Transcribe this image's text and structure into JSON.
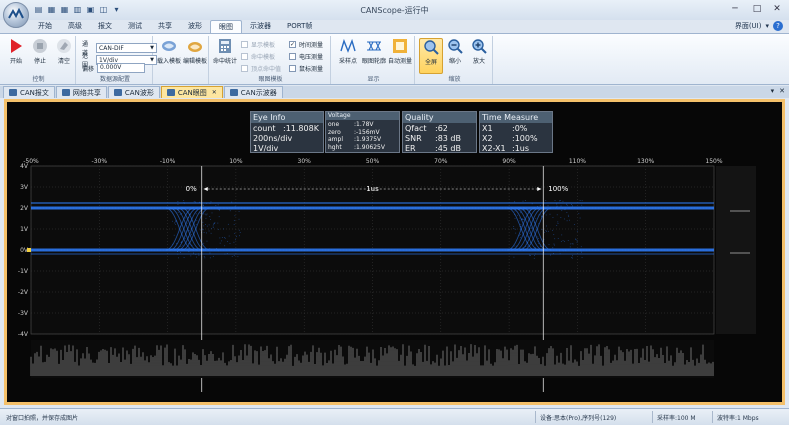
{
  "window": {
    "title": "CANScope-运行中",
    "minimize": "─",
    "maximize": "□",
    "close": "✕"
  },
  "ribbon": {
    "tabs": [
      "开始",
      "高级",
      "报文",
      "测试",
      "共享",
      "波形",
      "眼图",
      "示波器",
      "PORT帧"
    ],
    "active_tab": "眼图",
    "right_label": "界面(UI)",
    "right_arrow": "▾",
    "help": "?",
    "control": {
      "label": "控制",
      "start": "开始",
      "stop": "停止",
      "clear": "清空"
    },
    "data_source": {
      "label": "数据源配置",
      "channel_label": "通道",
      "channel_value": "CAN-DIF",
      "range_label": "范围",
      "range_value": "1V/div",
      "offset_label": "偏移",
      "offset_value": "0.000V"
    },
    "eye_template": {
      "label": "眼图模板",
      "load": "载入模板",
      "edit": "编辑模板"
    },
    "eye_analysis": {
      "label": "眼图模板",
      "stats": "命中统计",
      "show_template": "显示模板",
      "hit_template": "命中模板",
      "top_hit": "顶点命中值",
      "time_measure": "时间测量",
      "voltage_measure": "电压测量",
      "mouse_measure": "鼠标测量"
    },
    "display": {
      "label": "显示",
      "sample_point": "采样点",
      "eye_outline": "眼图轮廓",
      "auto_measure": "自动测量"
    },
    "zoom": {
      "label": "缩放",
      "fullscreen": "全屏",
      "zoom_out": "缩小",
      "zoom_in": "放大"
    }
  },
  "doc_tabs": [
    "CAN报文",
    "网络共享",
    "CAN波形",
    "CAN眼图",
    "CAN示波器"
  ],
  "active_doc_tab": "CAN眼图",
  "doc_controls": {
    "arrow": "▾",
    "close": "✕"
  },
  "eye_info": {
    "title": "Eye Info",
    "rows": [
      {
        "k": "count",
        "v": ":11.808K"
      },
      {
        "k": "200ns/div",
        "v": ""
      },
      {
        "k": "1V/div",
        "v": ""
      }
    ]
  },
  "voltage": {
    "title": "Voltage",
    "rows": [
      {
        "k": "one",
        "v": ":1.78V"
      },
      {
        "k": "zero",
        "v": ":-156mV"
      },
      {
        "k": "ampl",
        "v": ":1.9375V"
      },
      {
        "k": "hght",
        "v": ":1.90625V"
      }
    ]
  },
  "quality": {
    "title": "Quality",
    "rows": [
      {
        "k": "Qfact",
        "v": ":62"
      },
      {
        "k": "SNR",
        "v": ":83 dB"
      },
      {
        "k": "ER",
        "v": ":45 dB"
      }
    ]
  },
  "time_measure": {
    "title": "Time Measure",
    "rows": [
      {
        "k": "X1",
        "v": ":0%"
      },
      {
        "k": "X2",
        "v": ":100%"
      },
      {
        "k": "X2-X1",
        "v": ":1us"
      }
    ]
  },
  "eye_plot": {
    "x_ticks": [
      "-50%",
      "-30%",
      "-10%",
      "10%",
      "30%",
      "50%",
      "70%",
      "90%",
      "110%",
      "130%",
      "150%"
    ],
    "y_ticks": [
      "4V",
      "3V",
      "2V",
      "1V",
      "0V",
      "-1V",
      "-2V",
      "-3V",
      "-4V"
    ],
    "marker_left": "0%",
    "marker_right": "100%",
    "span_label": "1us",
    "trace_color": "#2f7fff",
    "marker_color": "#ffffff",
    "ground_marker_color": "#f2d040"
  },
  "status": {
    "left": "对窗口拍照，并保存成图片",
    "device": "设备:思本(Pro),序列号(129)",
    "sample_rate": "采样率:100 M",
    "baud_rate": "波特率:1 Mbps"
  }
}
